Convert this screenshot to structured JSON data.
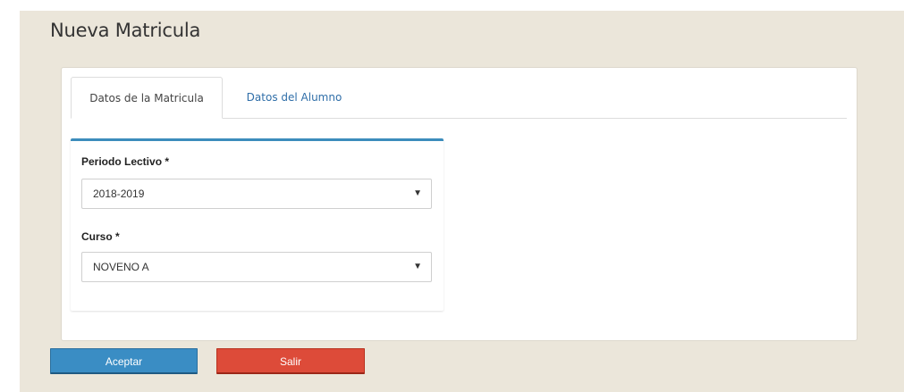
{
  "page": {
    "title": "Nueva Matricula"
  },
  "tabs": [
    {
      "label": "Datos de la Matricula",
      "active": true
    },
    {
      "label": "Datos del Alumno",
      "active": false
    }
  ],
  "form": {
    "periodo": {
      "label": "Periodo Lectivo *",
      "value": "2018-2019"
    },
    "curso": {
      "label": "Curso *",
      "value": "NOVENO A"
    }
  },
  "icons": {
    "dropdown": "caret-down-icon"
  },
  "buttons": {
    "accept": "Aceptar",
    "exit": "Salir"
  },
  "colors": {
    "background": "#ebe6da",
    "panel_accent": "#3c8dbc",
    "accept": "#3a8dc4",
    "exit": "#dd4b39",
    "tab_link": "#2f6ea8"
  }
}
